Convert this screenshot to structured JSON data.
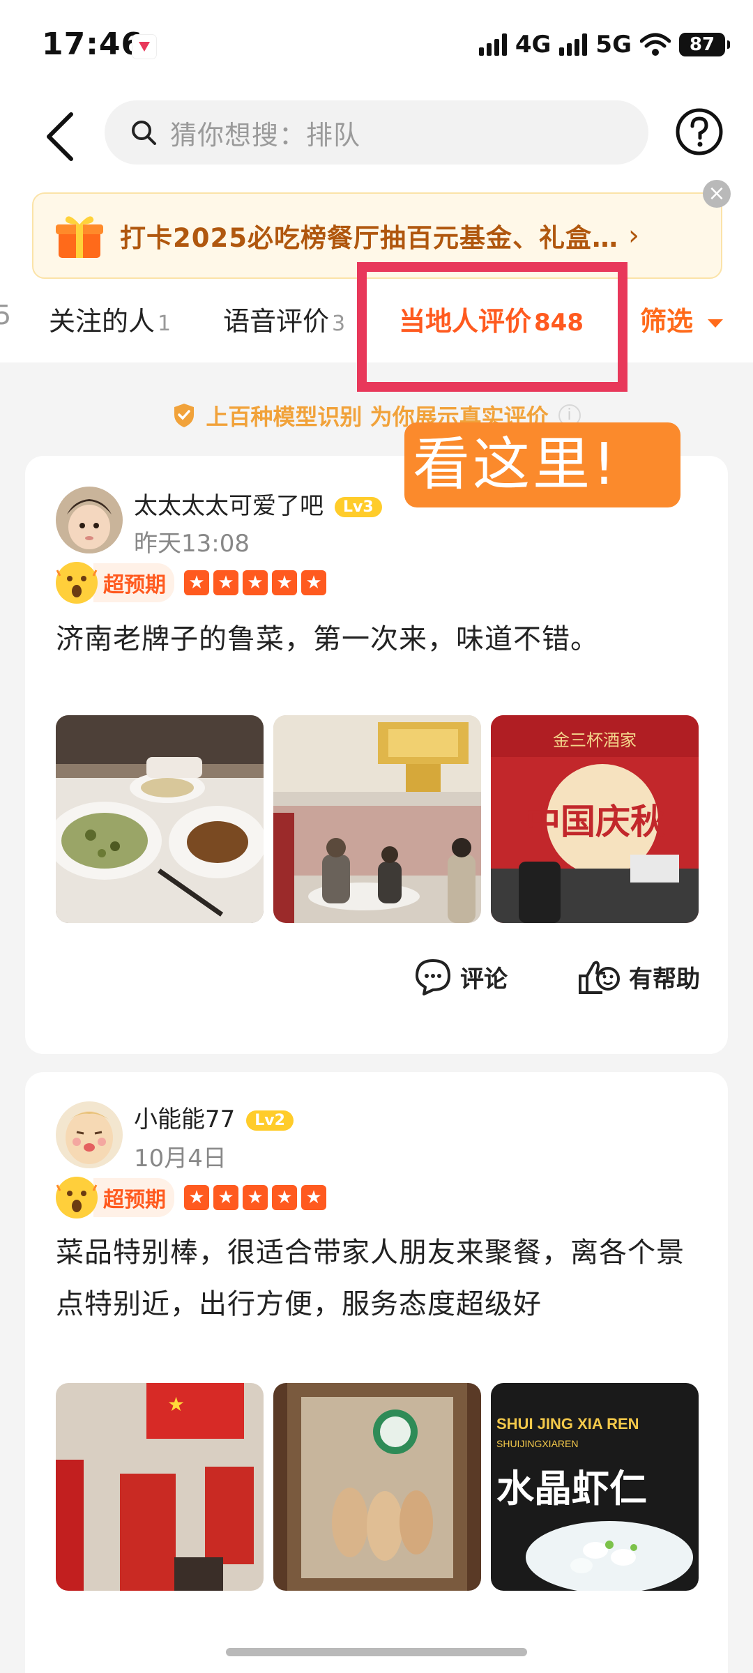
{
  "status_bar": {
    "time": "17:46",
    "network1": "4G",
    "network2": "5G",
    "battery": "87"
  },
  "search": {
    "placeholder": "猜你想搜：排队"
  },
  "promo": {
    "text": "打卡2025必吃榜餐厅抽百元基金、礼盒…",
    "close": "×"
  },
  "tabs": {
    "cut_label": "5",
    "items": [
      {
        "label": "关注的人",
        "count": "1"
      },
      {
        "label": "语音评价",
        "count": "3"
      },
      {
        "label": "当地人评价",
        "count": "848"
      }
    ],
    "filter": "筛选"
  },
  "verify_text": "上百种模型识别 为你展示真实评价",
  "callout": "看这里!",
  "reviews": [
    {
      "user": "太太太太可爱了吧",
      "level": "Lv3",
      "date": "昨天13:08",
      "badge": "超预期",
      "stars": 5,
      "content": "济南老牌子的鲁菜，第一次来，味道不错。",
      "comment_label": "评论",
      "helpful_label": "有帮助"
    },
    {
      "user": "小能能77",
      "level": "Lv2",
      "date": "10月4日",
      "badge": "超预期",
      "stars": 5,
      "content": "菜品特别棒，很适合带家人朋友来聚餐，离各个景点特别近，出行方便，服务态度超级好"
    }
  ],
  "photo_text": {
    "p3_brand": "金三杯酒家",
    "p3_main": "中国庆秋",
    "p6_line1": "SHUI JING XIA REN",
    "p6_line2": "SHUIJINGXIAREN",
    "p6_big": "水晶虾仁"
  },
  "colors": {
    "accent": "#ff5a1f",
    "highlight": "#e8385a",
    "callout": "#fb8a2c"
  }
}
